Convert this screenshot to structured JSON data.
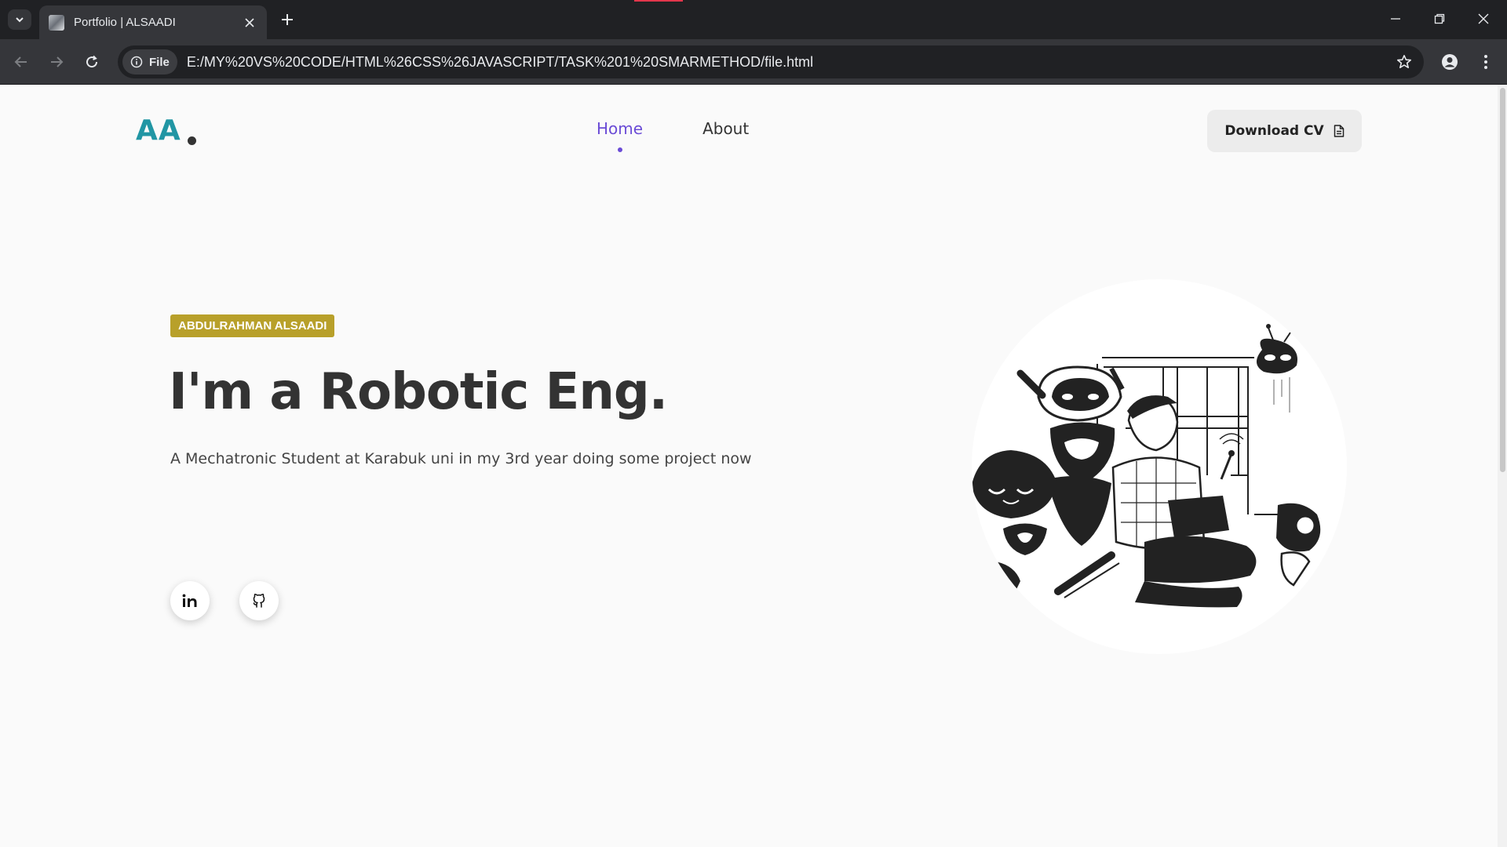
{
  "browser": {
    "tab_title": "Portfolio | ALSAADI",
    "site_chip": "File",
    "url": "E:/MY%20VS%20CODE/HTML%26CSS%26JAVASCRIPT/TASK%201%20SMARMETHOD/file.html"
  },
  "page": {
    "logo": "AA",
    "nav": [
      {
        "label": "Home",
        "active": true
      },
      {
        "label": "About",
        "active": false
      }
    ],
    "download_cv": "Download CV",
    "badge": "ABDULRAHMAN ALSAADI",
    "title": "I'm a Robotic Eng.",
    "description": "A Mechatronic Student at Karabuk uni in my 3rd year doing some project now",
    "social": [
      {
        "icon": "linkedin-icon"
      },
      {
        "icon": "github-icon"
      }
    ],
    "colors": {
      "logo": "#2196a4",
      "nav_active": "#6a4bd6",
      "badge": "#b8a02a",
      "text": "#333333"
    },
    "illustration": "robots-and-engineer-illustration"
  }
}
